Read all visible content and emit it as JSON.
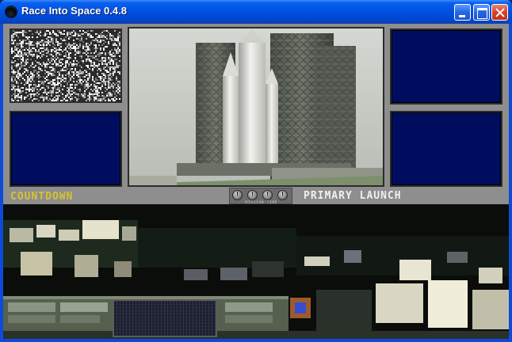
{
  "window": {
    "title": "Race Into Space 0.4.8",
    "controls": {
      "minimize": "minimize",
      "maximize": "maximize",
      "close": "close"
    }
  },
  "console": {
    "countdown_label": "COUNTDOWN",
    "phase_label": "PRIMARY LAUNCH",
    "timer_caption": "MISSION TIME",
    "colors": {
      "panel_gray": "#8e8e8e",
      "monitor_blue": "#000d5e",
      "countdown_yellow": "#d8c232",
      "phase_white": "#f0f0f0"
    }
  },
  "monitors": {
    "top_left": "static",
    "bottom_left": "blank",
    "top_right": "blank",
    "bottom_right": "blank",
    "main": "launch-pad-video"
  },
  "icons": [
    "app-icon",
    "minimize-icon",
    "maximize-icon",
    "close-icon",
    "knob-icon"
  ]
}
